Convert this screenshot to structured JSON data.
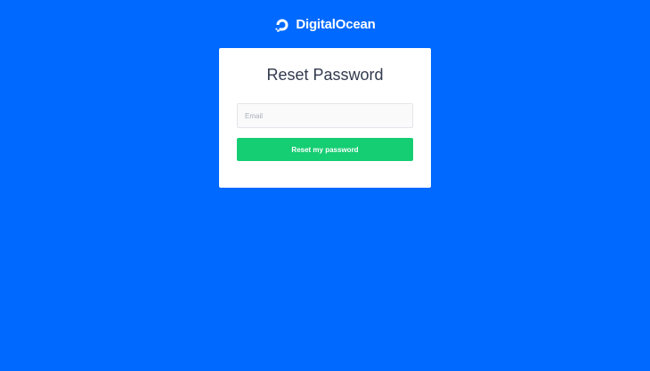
{
  "brand": {
    "name": "DigitalOcean",
    "logo_icon": "digitalocean-logo-icon"
  },
  "reset_form": {
    "title": "Reset Password",
    "email_value": "",
    "email_placeholder": "Email",
    "submit_label": "Reset my password"
  },
  "colors": {
    "background": "#0069ff",
    "card": "#ffffff",
    "button": "#15cd72",
    "title_text": "#31394d"
  }
}
